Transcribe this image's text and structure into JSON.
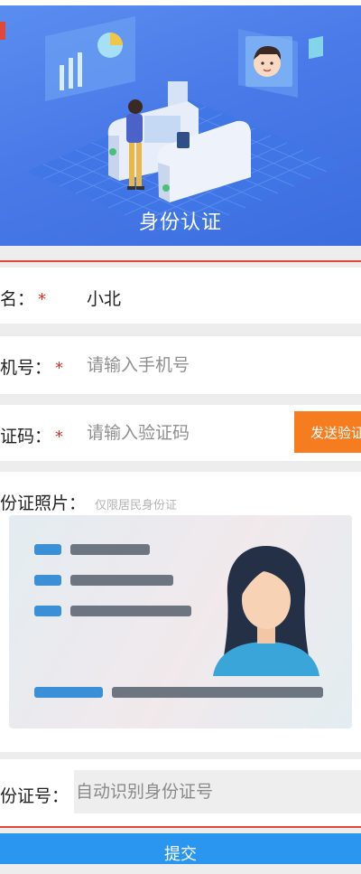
{
  "banner": {
    "title": "身份认证"
  },
  "form": {
    "name": {
      "label": "名：",
      "required_mark": "*",
      "value": "小北"
    },
    "phone": {
      "label": "机号：",
      "required_mark": "*",
      "placeholder": "请输入手机号"
    },
    "code": {
      "label": "证码：",
      "required_mark": "*",
      "placeholder": "请输入验证码",
      "send_button": "发送验证"
    },
    "id_photo": {
      "label": "份证照片：",
      "hint": "仅限居民身份证"
    },
    "id_number": {
      "label": "份证号：",
      "placeholder": "自动识别身份证号"
    }
  },
  "submit_label": "提交",
  "colors": {
    "banner": "#4a7ae8",
    "accent_red": "#e0483a",
    "send_button": "#f57c1f",
    "submit_button": "#2a96f0"
  }
}
